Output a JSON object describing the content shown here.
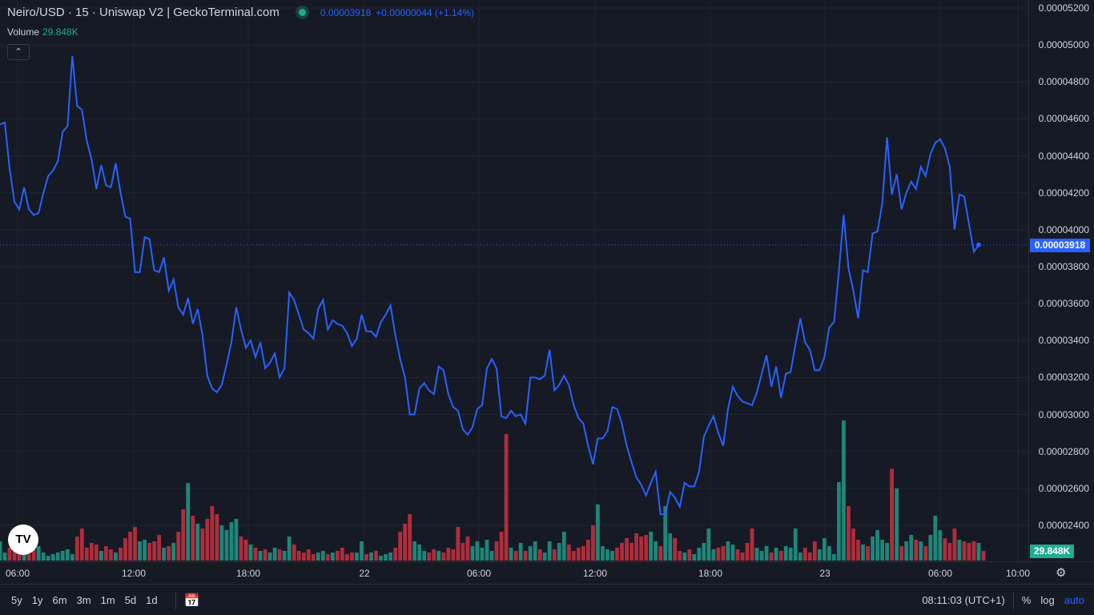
{
  "header": {
    "title": "Neiro/USD · 15 · Uniswap V2 | GeckoTerminal.com",
    "price": "0.00003918",
    "change": "+0.00000044 (+1.14%)",
    "volume_label": "Volume",
    "volume_value": "29.848K"
  },
  "price_axis": {
    "ticks": [
      "0.00005200",
      "0.00005000",
      "0.00004800",
      "0.00004600",
      "0.00004400",
      "0.00004200",
      "0.00004000",
      "0.00003800",
      "0.00003600",
      "0.00003400",
      "0.00003200",
      "0.00003000",
      "0.00002800",
      "0.00002600",
      "0.00002400"
    ],
    "current_label": "0.00003918",
    "volume_label": "29.848K"
  },
  "time_axis": {
    "ticks": [
      "06:00",
      "12:00",
      "18:00",
      "22",
      "06:00",
      "12:00",
      "18:00",
      "23",
      "06:00",
      "10:00"
    ]
  },
  "bottom": {
    "ranges": [
      "5y",
      "1y",
      "6m",
      "3m",
      "1m",
      "5d",
      "1d"
    ],
    "clock": "08:11:03 (UTC+1)",
    "percent": "%",
    "log": "log",
    "auto": "auto"
  },
  "icons": {
    "logo": "TV"
  },
  "colors": {
    "line": "#2962ff",
    "up": "#22ab94",
    "down": "#f23645"
  },
  "chart_data": {
    "type": "line",
    "unit": "price x 1e-6 USD",
    "ylim": [
      23.5,
      52.5
    ],
    "price": [
      45.7,
      45.8,
      43.3,
      41.5,
      41.1,
      42.3,
      41.1,
      40.8,
      40.9,
      42.0,
      42.9,
      43.2,
      43.7,
      45.3,
      45.6,
      49.4,
      46.7,
      46.5,
      44.8,
      43.8,
      42.2,
      43.5,
      42.4,
      42.3,
      43.6,
      42.0,
      40.7,
      40.6,
      37.7,
      37.7,
      39.6,
      39.5,
      37.8,
      37.7,
      38.5,
      36.7,
      37.3,
      35.8,
      35.4,
      36.3,
      34.9,
      35.7,
      34.3,
      32.1,
      31.4,
      31.2,
      31.6,
      32.7,
      33.9,
      35.8,
      34.6,
      33.6,
      34.0,
      33.1,
      33.9,
      32.5,
      32.8,
      33.3,
      32.0,
      32.5,
      36.6,
      36.2,
      35.4,
      34.6,
      34.4,
      34.1,
      35.7,
      36.2,
      34.6,
      35.1,
      34.9,
      34.8,
      34.4,
      33.7,
      34.1,
      35.4,
      34.5,
      34.5,
      34.2,
      35.0,
      35.4,
      35.9,
      34.3,
      33.0,
      32.0,
      30.0,
      30.0,
      31.4,
      31.7,
      31.3,
      31.1,
      32.6,
      32.4,
      31.1,
      30.4,
      30.2,
      29.2,
      28.9,
      29.3,
      30.3,
      30.5,
      32.5,
      33.0,
      32.5,
      29.9,
      29.8,
      30.2,
      29.9,
      30.0,
      29.5,
      32.0,
      32.0,
      31.9,
      32.1,
      33.5,
      31.3,
      31.6,
      32.1,
      31.6,
      30.5,
      29.8,
      29.5,
      28.3,
      27.3,
      28.7,
      28.7,
      29.1,
      30.4,
      30.3,
      29.5,
      28.3,
      27.4,
      26.6,
      26.2,
      25.6,
      26.3,
      26.9,
      24.6,
      24.6,
      25.8,
      25.5,
      25.0,
      26.3,
      26.1,
      26.1,
      26.9,
      28.8,
      29.4,
      29.9,
      29.0,
      28.3,
      30.3,
      31.5,
      31.0,
      30.7,
      30.6,
      30.5,
      31.2,
      32.2,
      33.2,
      31.5,
      32.6,
      30.9,
      32.2,
      32.3,
      33.8,
      35.2,
      33.9,
      33.5,
      32.4,
      32.4,
      33.1,
      34.7,
      35.0,
      37.7,
      40.8,
      37.9,
      36.7,
      35.2,
      37.8,
      37.7,
      39.8,
      39.9,
      41.4,
      45.0,
      41.9,
      43.0,
      41.1,
      42.0,
      42.6,
      42.2,
      43.4,
      42.9,
      44.1,
      44.7,
      44.9,
      44.4,
      43.4,
      40.0,
      41.9,
      41.8,
      40.3,
      38.8,
      39.18
    ],
    "volume_k": [
      60,
      25,
      40,
      30,
      35,
      30,
      20,
      35,
      45,
      25,
      15,
      20,
      25,
      30,
      35,
      20,
      75,
      100,
      40,
      55,
      50,
      30,
      45,
      35,
      25,
      40,
      70,
      90,
      105,
      60,
      65,
      55,
      60,
      80,
      40,
      45,
      55,
      90,
      160,
      242,
      140,
      115,
      100,
      130,
      170,
      145,
      110,
      95,
      120,
      130,
      75,
      65,
      50,
      40,
      30,
      35,
      25,
      40,
      35,
      30,
      75,
      50,
      30,
      25,
      35,
      20,
      25,
      30,
      20,
      25,
      30,
      40,
      20,
      25,
      25,
      60,
      20,
      25,
      30,
      15,
      20,
      25,
      40,
      90,
      115,
      145,
      60,
      50,
      30,
      25,
      35,
      30,
      25,
      40,
      35,
      105,
      55,
      75,
      45,
      60,
      40,
      65,
      30,
      60,
      90,
      395,
      40,
      30,
      55,
      30,
      45,
      60,
      35,
      25,
      60,
      35,
      55,
      90,
      50,
      30,
      40,
      45,
      65,
      110,
      175,
      45,
      35,
      30,
      40,
      55,
      70,
      55,
      85,
      75,
      80,
      90,
      60,
      45,
      170,
      85,
      70,
      30,
      25,
      35,
      20,
      40,
      55,
      100,
      35,
      40,
      45,
      60,
      50,
      35,
      25,
      55,
      100,
      40,
      30,
      45,
      25,
      40,
      30,
      45,
      40,
      100,
      25,
      40,
      25,
      60,
      35,
      70,
      45,
      20,
      245,
      437,
      170,
      100,
      65,
      50,
      45,
      75,
      95,
      65,
      55,
      287,
      225,
      45,
      60,
      80,
      65,
      60,
      45,
      80,
      140,
      95,
      70,
      55,
      100,
      65,
      60,
      55,
      60,
      55,
      29.848
    ]
  }
}
